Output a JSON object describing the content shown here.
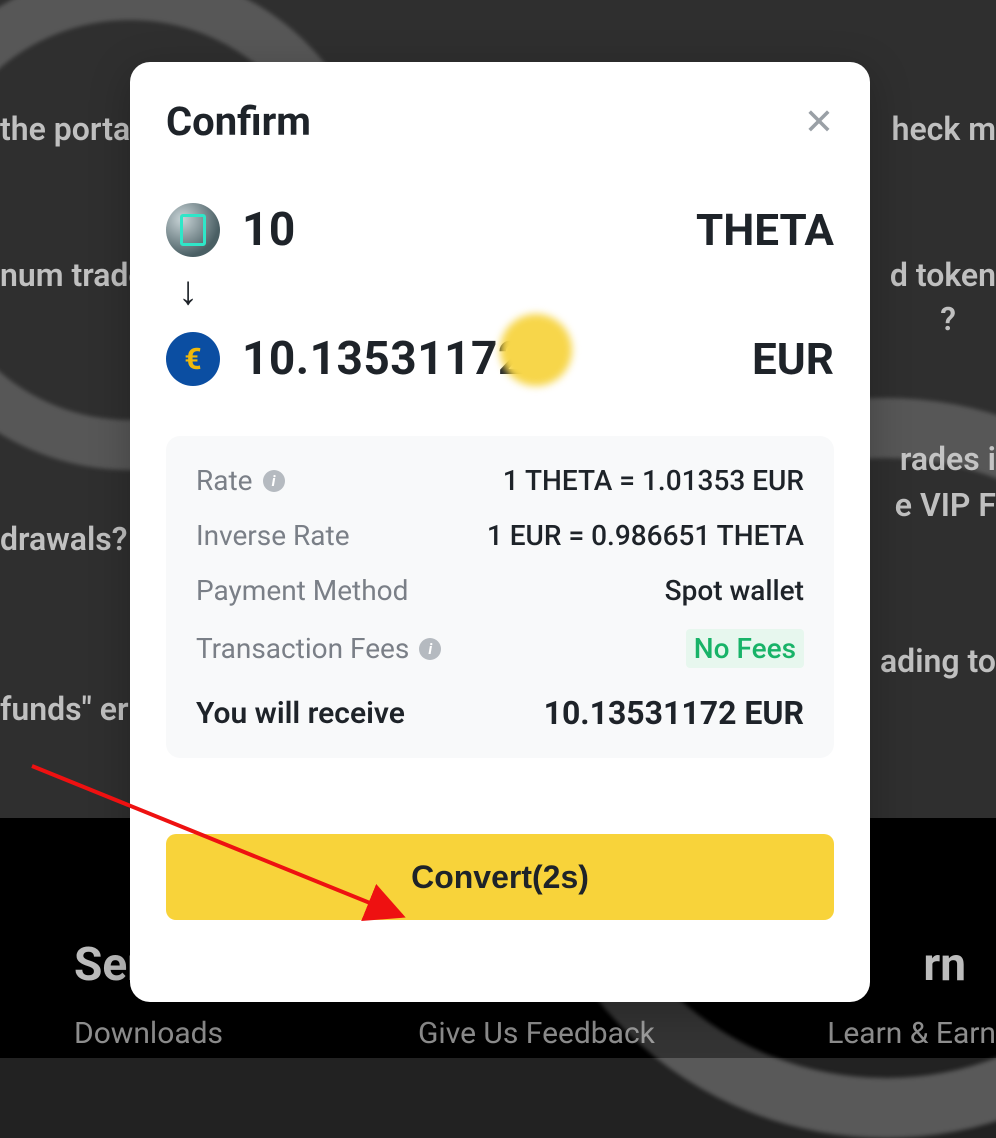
{
  "background": {
    "links": {
      "portal": "the porta",
      "check": "heck m",
      "trade": "num trade",
      "token": "d token",
      "q": "?",
      "trades": "rades i",
      "vip": "e VIP F",
      "withdrawals": "drawals?",
      "trading": "ading to",
      "funds": "funds\" er"
    },
    "footer": {
      "col1_title": "Ser",
      "col1_link": "Downloads",
      "col2_link": "Give Us Feedback",
      "col3_title": "rn",
      "col3_link": "Learn & Earn"
    }
  },
  "modal": {
    "title": "Confirm",
    "from": {
      "amount": "10",
      "symbol": "THETA"
    },
    "to": {
      "amount": "10.13531172",
      "symbol": "EUR"
    },
    "details": {
      "rate_label": "Rate",
      "rate_value": "1 THETA = 1.01353 EUR",
      "inverse_label": "Inverse Rate",
      "inverse_value": "1 EUR = 0.986651 THETA",
      "method_label": "Payment Method",
      "method_value": "Spot wallet",
      "fees_label": "Transaction Fees",
      "fees_value": "No Fees",
      "receive_label": "You will receive",
      "receive_value": "10.13531172 EUR"
    },
    "button": "Convert(2s)"
  }
}
